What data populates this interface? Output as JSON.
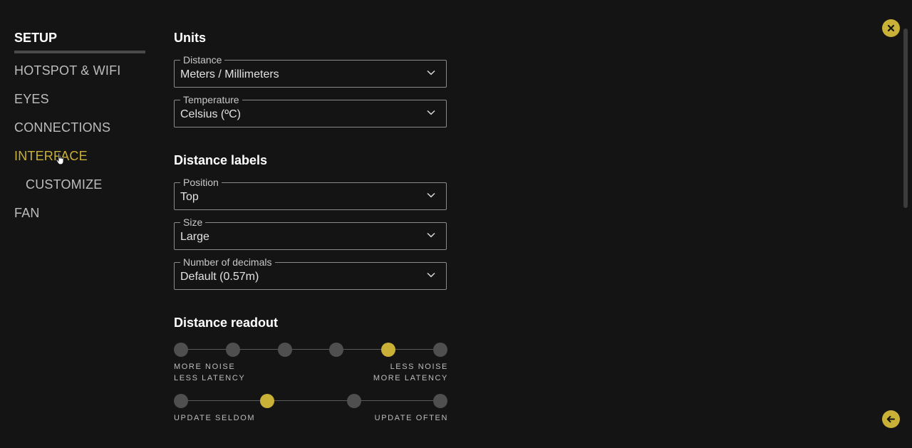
{
  "sidebar": {
    "header": "SETUP",
    "items": [
      {
        "label": "HOTSPOT & WIFI"
      },
      {
        "label": "EYES"
      },
      {
        "label": "CONNECTIONS"
      },
      {
        "label": "INTERFACE"
      },
      {
        "label": "CUSTOMIZE"
      },
      {
        "label": "FAN"
      }
    ],
    "active_item": "INTERFACE"
  },
  "sections": {
    "units": {
      "title": "Units",
      "distance": {
        "label": "Distance",
        "value": "Meters / Millimeters"
      },
      "temperature": {
        "label": "Temperature",
        "value": "Celsius (ºC)"
      }
    },
    "distance_labels": {
      "title": "Distance labels",
      "position": {
        "label": "Position",
        "value": "Top"
      },
      "size": {
        "label": "Size",
        "value": "Large"
      },
      "decimals": {
        "label": "Number of decimals",
        "value": "Default (0.57m)"
      }
    },
    "distance_readout": {
      "title": "Distance readout",
      "noise_slider": {
        "steps": 6,
        "selected_index": 4,
        "left_label_1": "MORE NOISE",
        "left_label_2": "LESS LATENCY",
        "right_label_1": "LESS NOISE",
        "right_label_2": "MORE LATENCY"
      },
      "update_slider": {
        "steps": 4,
        "selected_index": 1,
        "left_label": "UPDATE SELDOM",
        "right_label": "UPDATE OFTEN"
      }
    }
  },
  "icons": {
    "close": "close-icon",
    "back": "arrow-left-icon",
    "dropdown": "chevron-down-icon"
  },
  "colors": {
    "background": "#141414",
    "accent": "#c9b037",
    "inactive_dot": "#4f4f4f"
  }
}
